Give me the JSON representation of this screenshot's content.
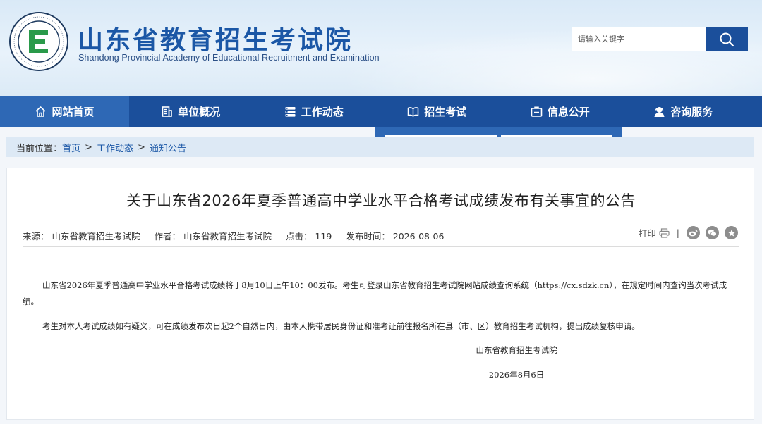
{
  "header": {
    "title_cn": "山东省教育招生考试院",
    "title_en": "Shandong Provincial Academy of Educational Recruitment and Examination",
    "logo": {
      "icon": "academy-logo-icon",
      "letter": "E",
      "ring_text": "Shandong Educational Admission & Examination",
      "ring_text_cn": "山东教育招生考试"
    },
    "search": {
      "placeholder": "请输入关键字",
      "icon": "search-icon"
    }
  },
  "nav": {
    "items": [
      {
        "label": "网站首页",
        "icon": "home-icon",
        "active": true
      },
      {
        "label": "单位概况",
        "icon": "building-icon",
        "active": false
      },
      {
        "label": "工作动态",
        "icon": "list-icon",
        "active": false
      },
      {
        "label": "招生考试",
        "icon": "book-icon",
        "active": false
      },
      {
        "label": "信息公开",
        "icon": "info-box-icon",
        "active": false
      },
      {
        "label": "咨询服务",
        "icon": "user-service-icon",
        "active": false
      }
    ]
  },
  "breadcrumb": {
    "prefix": "当前位置：",
    "items": [
      "首页",
      "工作动态",
      "通知公告"
    ],
    "separator": ">"
  },
  "article": {
    "title": "关于山东省2026年夏季普通高中学业水平合格考试成绩发布有关事宜的公告",
    "meta": {
      "source": "来源：  山东省教育招生考试院",
      "author": "作者：  山东省教育招生考试院",
      "clicks": "点击：  119",
      "published": "发布时间：  2026-08-06"
    },
    "tools": {
      "print_label": "打印",
      "divider": "|"
    },
    "paragraphs": [
      "山东省2026年夏季普通高中学业水平合格考试成绩将于8月10日上午10：00发布。考生可登录山东省教育招生考试院网站成绩查询系统（https://cx.sdzk.cn），在规定时间内查询当次考试成绩。",
      "考生对本人考试成绩如有疑义，可在成绩发布次日起2个自然日内，由本人携带居民身份证和准考证前往报名所在县（市、区）教育招生考试机构，提出成绩复核申请。"
    ],
    "signature": "山东省教育招生考试院",
    "date": "2026年8月6日"
  },
  "colors": {
    "brand_blue": "#1b57a6",
    "nav_blue": "#1b4f9b",
    "nav_active": "#2e68b5",
    "breadcrumb_bg": "#dde9f5"
  }
}
